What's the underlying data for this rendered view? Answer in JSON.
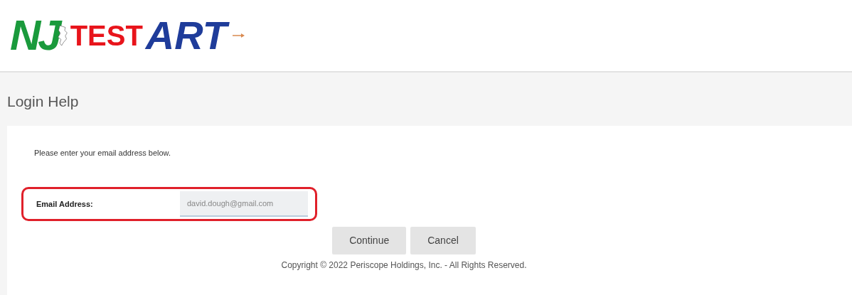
{
  "logo": {
    "left": "NJ",
    "right": "ART",
    "overlay": "TEST"
  },
  "page_title": "Login Help",
  "instructions": "Please enter your email address below.",
  "email_field": {
    "label": "Email Address:",
    "value": "david.dough@gmail.com",
    "highlighted": true
  },
  "buttons": [
    "Continue",
    "Cancel"
  ],
  "footer": "Copyright © 2022 Periscope Holdings, Inc. - All Rights Reserved."
}
